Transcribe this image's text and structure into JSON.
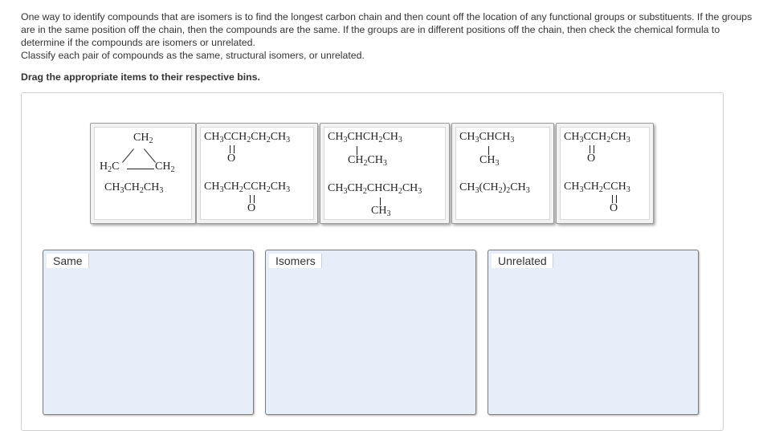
{
  "prompt": {
    "line1": "One way to identify compounds that are isomers is to find the longest carbon chain and then count off the location of any functional groups or substituents. If the groups are in the same position off the chain, then the compounds are the same. If the groups are in different positions off the chain, then check the chemical formula to determine if the compounds are isomers or unrelated.",
    "line2": "Classify each pair of compounds as the same, structural isomers, or unrelated."
  },
  "instruction": "Drag the appropriate items to their respective bins.",
  "bins": [
    {
      "label": "Same"
    },
    {
      "label": "Isomers"
    },
    {
      "label": "Unrelated"
    }
  ],
  "cards": {
    "c1": {
      "ch2_top": "CH",
      "h2c": "H",
      "c": "C",
      "ch2_right": "CH",
      "bottom": "CH3CH2CH3"
    },
    "c2": {
      "top": "CH3CCH2CH2CH3",
      "o_top": "O",
      "bottom": "CH3CH2CCH2CH3",
      "o_bottom": "O"
    },
    "c3": {
      "top": "CH3CHCH2CH3",
      "mid": "CH2CH3",
      "bottom": "CH3CH2CHCH2CH3",
      "low": "CH3"
    },
    "c4": {
      "top": "CH3CHCH3",
      "mid": "CH3",
      "bottom": "CH3(CH2)2CH3"
    },
    "c5": {
      "top": "CH3CCH2CH3",
      "o_top": "O",
      "bottom": "CH3CH2CCH3",
      "o_bottom": "O"
    }
  }
}
